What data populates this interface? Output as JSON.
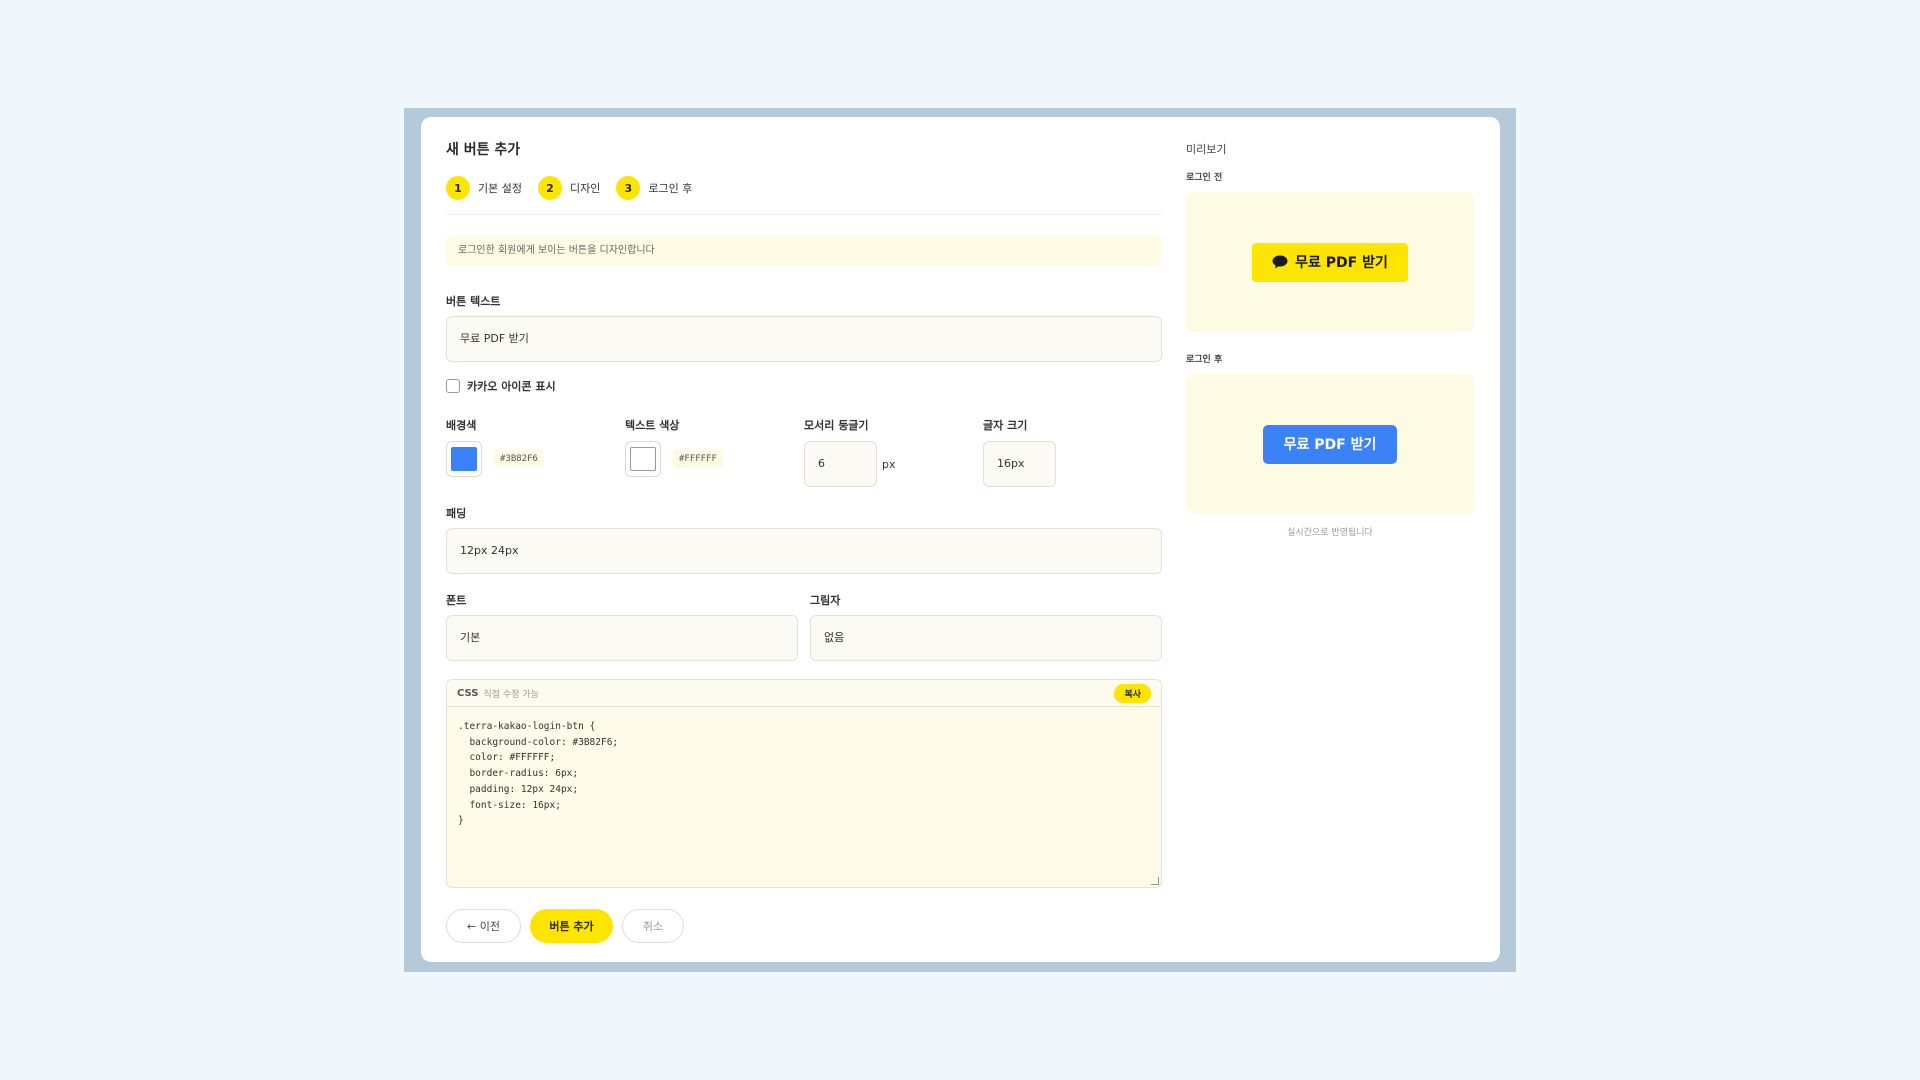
{
  "modal": {
    "title": "새 버튼 추가",
    "steps": [
      {
        "num": "1",
        "label": "기본 설정"
      },
      {
        "num": "2",
        "label": "디자인"
      },
      {
        "num": "3",
        "label": "로그인 후"
      }
    ],
    "notice": "로그인한 회원에게 보이는 버튼을 디자인합니다",
    "button_text": {
      "label": "버튼 텍스트",
      "value": "무료 PDF 받기"
    },
    "kakao_icon": {
      "label": "카카오 아이콘 표시",
      "checked": false
    },
    "bg_color": {
      "label": "배경색",
      "value": "#3B82F6"
    },
    "text_color": {
      "label": "텍스트 색상",
      "value": "#FFFFFF"
    },
    "radius": {
      "label": "모서리 둥글기",
      "value": "6",
      "unit": "px"
    },
    "font_size": {
      "label": "글자 크기",
      "value": "16px"
    },
    "padding": {
      "label": "패딩",
      "value": "12px 24px"
    },
    "font": {
      "label": "폰트",
      "value": "기본"
    },
    "shadow": {
      "label": "그림자",
      "value": "없음"
    },
    "css": {
      "title": "CSS",
      "subtitle": "직접 수정 가능",
      "copy_label": "복사",
      "code": ".terra-kakao-login-btn {\n  background-color: #3B82F6;\n  color: #FFFFFF;\n  border-radius: 6px;\n  padding: 12px 24px;\n  font-size: 16px;\n}"
    },
    "actions": {
      "prev": "← 이전",
      "add": "버튼 추가",
      "cancel": "취소"
    }
  },
  "preview": {
    "title": "미리보기",
    "before_label": "로그인 전",
    "before_button": "무료 PDF 받기",
    "after_label": "로그인 후",
    "after_button": "무료 PDF 받기",
    "realtime_note": "실시간으로 반영됩니다"
  },
  "colors": {
    "page_bg": "#eff7fd",
    "backdrop": "#b4c9da",
    "kakao_yellow": "#fee500",
    "blue": "#3b82f6",
    "white": "#ffffff"
  }
}
